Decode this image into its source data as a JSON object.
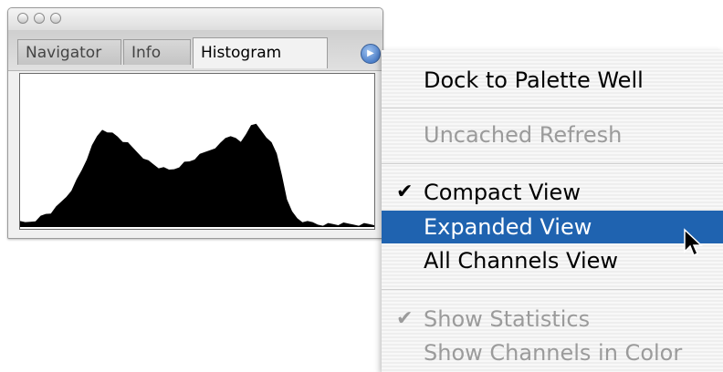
{
  "palette": {
    "tabs": [
      {
        "label": "Navigator",
        "active": false
      },
      {
        "label": "Info",
        "active": false
      },
      {
        "label": "Histogram",
        "active": true
      }
    ],
    "flyout_icon": "triangle-right-icon"
  },
  "histogram": {
    "fill_color": "#000000",
    "levels": [
      0.03,
      0.03,
      0.04,
      0.05,
      0.07,
      0.09,
      0.1,
      0.13,
      0.17,
      0.21,
      0.26,
      0.32,
      0.39,
      0.47,
      0.55,
      0.62,
      0.67,
      0.66,
      0.64,
      0.62,
      0.59,
      0.57,
      0.54,
      0.51,
      0.48,
      0.45,
      0.43,
      0.41,
      0.4,
      0.39,
      0.4,
      0.42,
      0.44,
      0.45,
      0.47,
      0.49,
      0.51,
      0.53,
      0.55,
      0.57,
      0.61,
      0.63,
      0.6,
      0.58,
      0.64,
      0.71,
      0.7,
      0.66,
      0.62,
      0.57,
      0.5,
      0.36,
      0.2,
      0.1,
      0.06,
      0.04,
      0.03,
      0.03,
      0.02,
      0.02,
      0.02,
      0.02,
      0.02,
      0.02,
      0.02,
      0.02,
      0.02,
      0.02,
      0.02,
      0.02
    ]
  },
  "menu": {
    "items": [
      {
        "label": "Dock to Palette Well",
        "enabled": true,
        "checked": false,
        "highlighted": false
      },
      {
        "label": "Uncached Refresh",
        "enabled": false,
        "checked": false,
        "highlighted": false
      },
      {
        "label": "Compact View",
        "enabled": true,
        "checked": true,
        "highlighted": false
      },
      {
        "label": "Expanded View",
        "enabled": true,
        "checked": false,
        "highlighted": true
      },
      {
        "label": "All Channels View",
        "enabled": true,
        "checked": false,
        "highlighted": false
      },
      {
        "label": "Show Statistics",
        "enabled": false,
        "checked": true,
        "highlighted": false
      },
      {
        "label": "Show Channels in Color",
        "enabled": false,
        "checked": false,
        "highlighted": false
      }
    ],
    "check_glyph": "✔",
    "highlight_color": "#1f63b0"
  }
}
